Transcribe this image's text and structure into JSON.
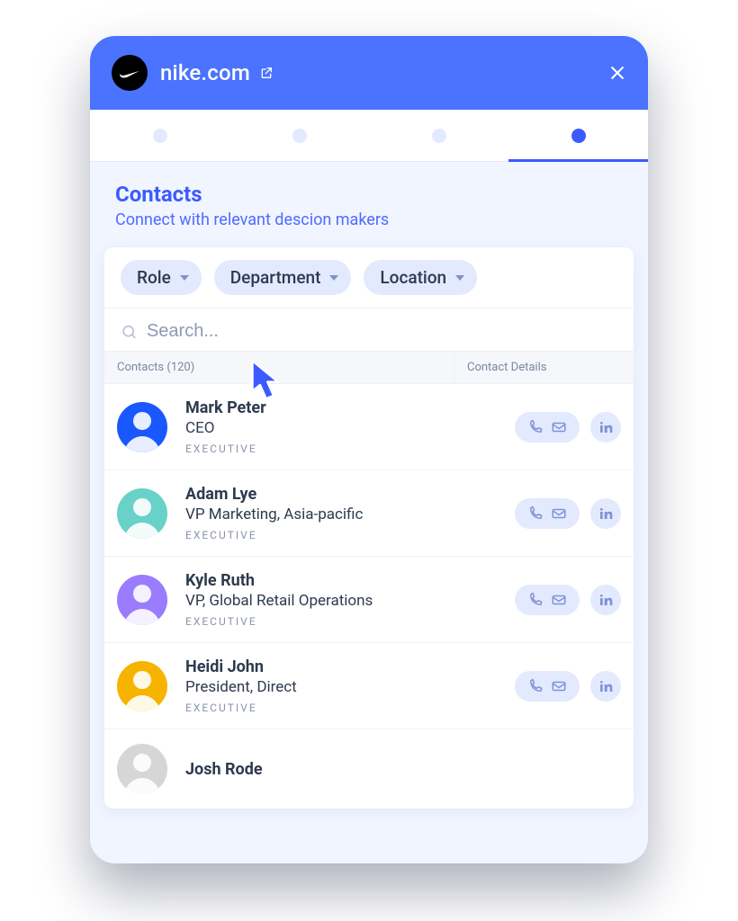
{
  "header": {
    "domain_label": "nike.com"
  },
  "tabs": {
    "count": 4,
    "active_index": 3
  },
  "section": {
    "title": "Contacts",
    "subtitle": "Connect with relevant descion makers"
  },
  "filters": [
    {
      "label": "Role"
    },
    {
      "label": "Department"
    },
    {
      "label": "Location"
    }
  ],
  "search": {
    "placeholder": "Search..."
  },
  "table": {
    "col_contacts_label": "Contacts (120)",
    "col_details_label": "Contact Details"
  },
  "contacts": [
    {
      "name": "Mark Peter",
      "title": "CEO",
      "tag": "EXECUTIVE",
      "avatar_bg": "#1957FF"
    },
    {
      "name": "Adam Lye",
      "title": "VP Marketing, Asia-pacific",
      "tag": "EXECUTIVE",
      "avatar_bg": "#68D1C8"
    },
    {
      "name": "Kyle Ruth",
      "title": "VP, Global Retail Operations",
      "tag": "EXECUTIVE",
      "avatar_bg": "#9A7CFF"
    },
    {
      "name": "Heidi John",
      "title": "President, Direct",
      "tag": "EXECUTIVE",
      "avatar_bg": "#F6B400"
    },
    {
      "name": "Josh Rode",
      "title": "",
      "tag": "",
      "avatar_bg": "#D6D6D6"
    }
  ]
}
